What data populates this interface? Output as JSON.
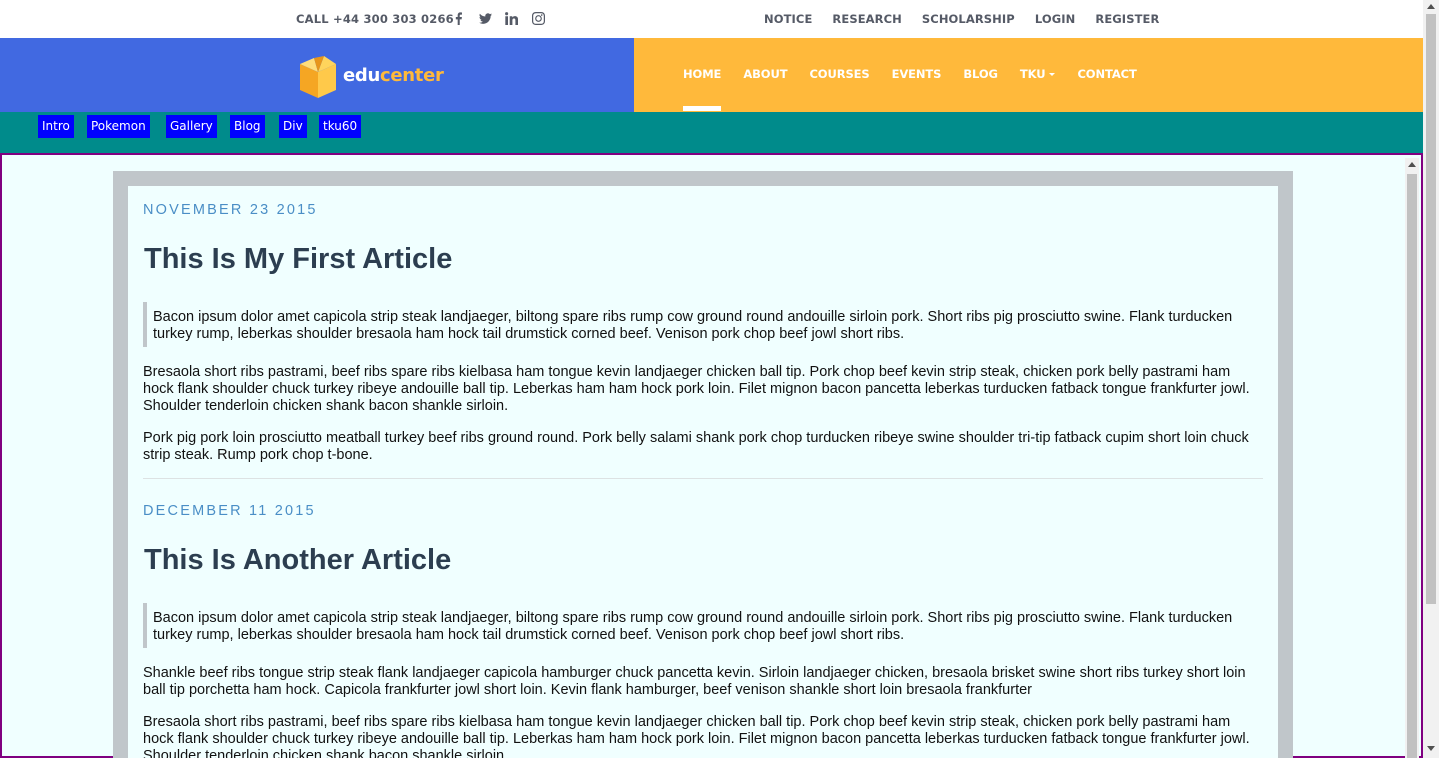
{
  "topbar": {
    "call": "CALL +44 300 303 0266",
    "social": [
      "facebook-icon",
      "twitter-icon",
      "linkedin-icon",
      "instagram-icon"
    ],
    "links": [
      "NOTICE",
      "RESEARCH",
      "SCHOLARSHIP",
      "LOGIN",
      "REGISTER"
    ]
  },
  "logo": {
    "part1": "edu",
    "part2": "center"
  },
  "nav": {
    "items": [
      "HOME",
      "ABOUT",
      "COURSES",
      "EVENTS",
      "BLOG",
      "TKU",
      "CONTACT"
    ],
    "active": "HOME"
  },
  "subnav": {
    "items": [
      "Intro",
      "Pokemon",
      "Gallery",
      "Blog",
      "Div",
      "tku60"
    ]
  },
  "articles": [
    {
      "date": "NOVEMBER 23 2015",
      "title": "This Is My First Article",
      "quote": "Bacon ipsum dolor amet capicola strip steak landjaeger, biltong spare ribs rump cow ground round andouille sirloin pork. Short ribs pig prosciutto swine. Flank turducken turkey rump, leberkas shoulder bresaola ham hock tail drumstick corned beef. Venison pork chop beef jowl short ribs.",
      "paragraphs": [
        "Bresaola short ribs pastrami, beef ribs spare ribs kielbasa ham tongue kevin landjaeger chicken ball tip. Pork chop beef kevin strip steak, chicken pork belly pastrami ham hock flank shoulder chuck turkey ribeye andouille ball tip. Leberkas ham ham hock pork loin. Filet mignon bacon pancetta leberkas turducken fatback tongue frankfurter jowl. Shoulder tenderloin chicken shank bacon shankle sirloin.",
        "Pork pig pork loin prosciutto meatball turkey beef ribs ground round. Pork belly salami shank pork chop turducken ribeye swine shoulder tri-tip fatback cupim short loin chuck strip steak. Rump pork chop t-bone."
      ]
    },
    {
      "date": "DECEMBER 11 2015",
      "title": "This Is Another Article",
      "quote": "Bacon ipsum dolor amet capicola strip steak landjaeger, biltong spare ribs rump cow ground round andouille sirloin pork. Short ribs pig prosciutto swine. Flank turducken turkey rump, leberkas shoulder bresaola ham hock tail drumstick corned beef. Venison pork chop beef jowl short ribs.",
      "paragraphs": [
        "Shankle beef ribs tongue strip steak flank landjaeger capicola hamburger chuck pancetta kevin. Sirloin landjaeger chicken, bresaola brisket swine short ribs turkey short loin ball tip porchetta ham hock. Capicola frankfurter jowl short loin. Kevin flank hamburger, beef venison shankle short loin bresaola frankfurter",
        "Bresaola short ribs pastrami, beef ribs spare ribs kielbasa ham tongue kevin landjaeger chicken ball tip. Pork chop beef kevin strip steak, chicken pork belly pastrami ham hock flank shoulder chuck turkey ribeye andouille ball tip. Leberkas ham ham hock pork loin. Filet mignon bacon pancetta leberkas turducken fatback tongue frankfurter jowl. Shoulder tenderloin chicken shank bacon shankle sirloin."
      ]
    }
  ],
  "colors": {
    "header_blue": "#4169e1",
    "header_orange": "#ffb93b",
    "subnav_teal": "#008b8b",
    "chip_blue": "#0000ff",
    "frame_border": "#800080",
    "content_bg": "#f0ffff",
    "date_blue": "#4a8ec6",
    "title_dark": "#2c3e50"
  }
}
